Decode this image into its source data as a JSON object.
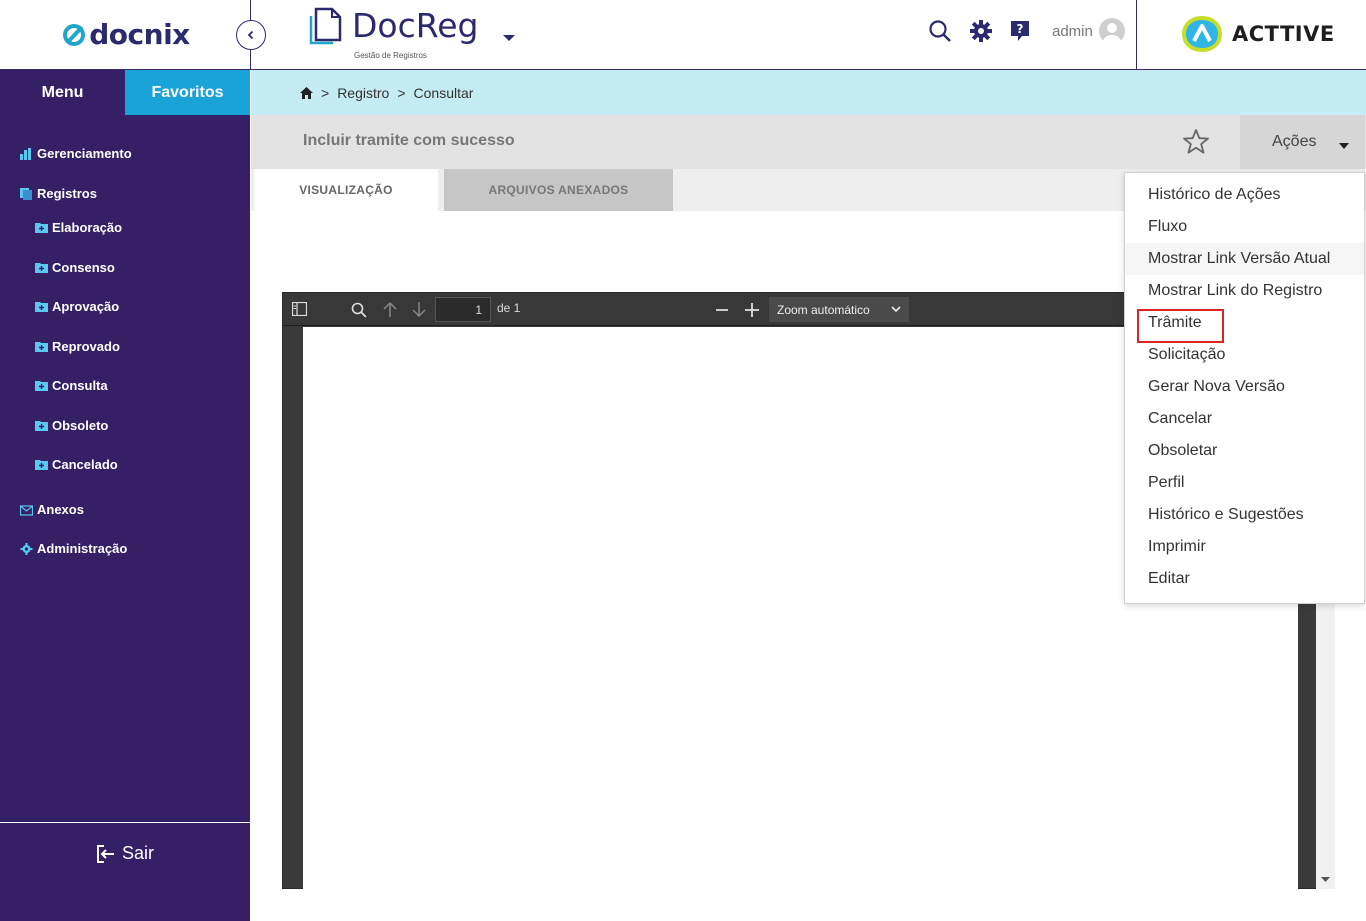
{
  "header": {
    "brand": "docnix",
    "app_title": "DocReg",
    "app_subtitle": "Gestão de Registros",
    "user": "admin",
    "partner_brand": "ACTTIVE"
  },
  "sidebar": {
    "tabs": [
      {
        "label": "Menu"
      },
      {
        "label": "Favoritos"
      }
    ],
    "items": [
      {
        "label": "Gerenciamento"
      },
      {
        "label": "Registros"
      },
      {
        "label": "Elaboração"
      },
      {
        "label": "Consenso"
      },
      {
        "label": "Aprovação"
      },
      {
        "label": "Reprovado"
      },
      {
        "label": "Consulta"
      },
      {
        "label": "Obsoleto"
      },
      {
        "label": "Cancelado"
      },
      {
        "label": "Anexos"
      },
      {
        "label": "Administração"
      }
    ],
    "logout": "Sair"
  },
  "breadcrumb": {
    "items": [
      "Registro",
      "Consultar"
    ],
    "separator": ">"
  },
  "page": {
    "title": "Incluir tramite com sucesso",
    "actions_label": "Ações"
  },
  "tabs": [
    {
      "label": "VISUALIZAÇÃO"
    },
    {
      "label": "ARQUIVOS ANEXADOS"
    }
  ],
  "viewer": {
    "page_number": "1",
    "page_total": "de 1",
    "zoom": "Zoom automático"
  },
  "actions_menu": [
    {
      "label": "Histórico de Ações"
    },
    {
      "label": "Fluxo"
    },
    {
      "label": "Mostrar Link Versão Atual"
    },
    {
      "label": "Mostrar Link do Registro"
    },
    {
      "label": "Trâmite"
    },
    {
      "label": "Solicitação"
    },
    {
      "label": "Gerar Nova Versão"
    },
    {
      "label": "Cancelar"
    },
    {
      "label": "Obsoletar"
    },
    {
      "label": "Perfil"
    },
    {
      "label": "Histórico e Sugestões"
    },
    {
      "label": "Imprimir"
    },
    {
      "label": "Editar"
    }
  ]
}
